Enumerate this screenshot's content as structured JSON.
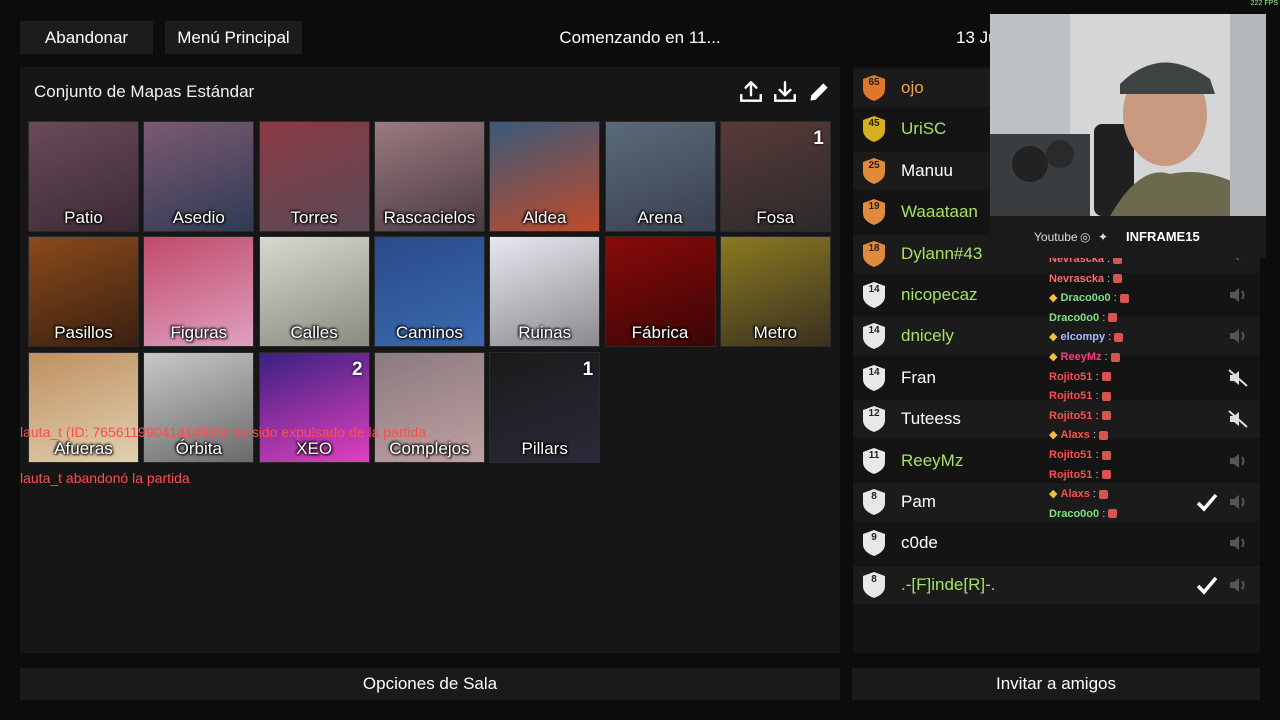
{
  "header": {
    "leave_label": "Abandonar",
    "menu_label": "Menú Principal",
    "countdown": "Comenzando en 11...",
    "date_partial": "13 Ju"
  },
  "maps": {
    "title": "Conjunto de Mapas Estándar",
    "tools": [
      "upload-icon",
      "download-icon",
      "edit-icon"
    ],
    "tiles": [
      {
        "name": "Patio",
        "votes": ""
      },
      {
        "name": "Asedio",
        "votes": ""
      },
      {
        "name": "Torres",
        "votes": ""
      },
      {
        "name": "Rascacielos",
        "votes": ""
      },
      {
        "name": "Aldea",
        "votes": ""
      },
      {
        "name": "Arena",
        "votes": ""
      },
      {
        "name": "Fosa",
        "votes": "1"
      },
      {
        "name": "Pasillos",
        "votes": ""
      },
      {
        "name": "Figuras",
        "votes": ""
      },
      {
        "name": "Calles",
        "votes": ""
      },
      {
        "name": "Caminos",
        "votes": ""
      },
      {
        "name": "Ruinas",
        "votes": ""
      },
      {
        "name": "Fábrica",
        "votes": ""
      },
      {
        "name": "Metro",
        "votes": ""
      },
      {
        "name": "Afueras",
        "votes": ""
      },
      {
        "name": "Órbita",
        "votes": ""
      },
      {
        "name": "XEO",
        "votes": "2"
      },
      {
        "name": "Complejos",
        "votes": ""
      },
      {
        "name": "Pillars",
        "votes": "1"
      }
    ]
  },
  "log": {
    "kick_message": "lauta_t (ID: 76561199041418985) ha sido expulsado de la partida",
    "left_message": "lauta_t abandonó la partida"
  },
  "bottom": {
    "room_options": "Opciones de Sala",
    "invite": "Invitar a amigos"
  },
  "players": [
    {
      "name": "ojo",
      "level": "65",
      "color": "#f0a050",
      "badge": "#e0762a",
      "ready": false,
      "muted": false
    },
    {
      "name": "UriSC",
      "level": "45",
      "color": "#a8e060",
      "badge": "#d4b020",
      "ready": false,
      "muted": false
    },
    {
      "name": "Manuu",
      "level": "25",
      "color": "#ffffff",
      "badge": "#e08a3a",
      "ready": false,
      "muted": false
    },
    {
      "name": "Waaataan",
      "level": "19",
      "color": "#a8e060",
      "badge": "#e08a3a",
      "ready": false,
      "muted": false
    },
    {
      "name": "Dylann#43",
      "level": "18",
      "color": "#a8e060",
      "badge": "#e08a3a",
      "ready": false,
      "muted": false
    },
    {
      "name": "nicopecaz",
      "level": "14",
      "color": "#a8e060",
      "badge": "#e8e8e8",
      "ready": false,
      "muted": false
    },
    {
      "name": "dnicely",
      "level": "14",
      "color": "#a8e060",
      "badge": "#e8e8e8",
      "ready": false,
      "muted": false
    },
    {
      "name": "Fran",
      "level": "14",
      "color": "#ffffff",
      "badge": "#e8e8e8",
      "ready": false,
      "muted": true
    },
    {
      "name": "Tuteess",
      "level": "12",
      "color": "#ffffff",
      "badge": "#e8e8e8",
      "ready": false,
      "muted": true
    },
    {
      "name": "ReeyMz",
      "level": "11",
      "color": "#a8e060",
      "badge": "#e8e8e8",
      "ready": false,
      "muted": false
    },
    {
      "name": "Pam",
      "level": "8",
      "color": "#ffffff",
      "badge": "#e8e8e8",
      "ready": true,
      "muted": false
    },
    {
      "name": "c0de",
      "level": "9",
      "color": "#ffffff",
      "badge": "#e8e8e8",
      "ready": false,
      "muted": false
    },
    {
      "name": ".-[F]inde[R]-.",
      "level": "8",
      "color": "#a8e060",
      "badge": "#e8e8e8",
      "ready": true,
      "muted": false
    }
  ],
  "chat": [
    {
      "user": "Nevrascka",
      "color": "#ff6b6b",
      "badges": false
    },
    {
      "user": "Nevrascka",
      "color": "#ff6b6b",
      "badges": false
    },
    {
      "user": "Draco0o0",
      "color": "#7fe07f",
      "badges": true
    },
    {
      "user": "Draco0o0",
      "color": "#7fe07f",
      "badges": false
    },
    {
      "user": "elcompy",
      "color": "#a9b8ff",
      "badges": true
    },
    {
      "user": "ReeyMz",
      "color": "#ff3b7d",
      "badges": true
    },
    {
      "user": "Rojito51",
      "color": "#ff4d4d",
      "badges": false
    },
    {
      "user": "Rojito51",
      "color": "#ff4d4d",
      "badges": false
    },
    {
      "user": "Rojito51",
      "color": "#ff4d4d",
      "badges": false
    },
    {
      "user": "Alaxs",
      "color": "#ff4d4d",
      "badges": true
    },
    {
      "user": "Rojito51",
      "color": "#ff4d4d",
      "badges": false
    },
    {
      "user": "Rojito51",
      "color": "#ff4d4d",
      "badges": false
    },
    {
      "user": "Alaxs",
      "color": "#ff4d4d",
      "badges": true
    },
    {
      "user": "Draco0o0",
      "color": "#7fe07f",
      "badges": false
    }
  ],
  "webcam": {
    "youtube": "Youtube",
    "handle": "INFRAME15",
    "fps": "222 FPS"
  }
}
